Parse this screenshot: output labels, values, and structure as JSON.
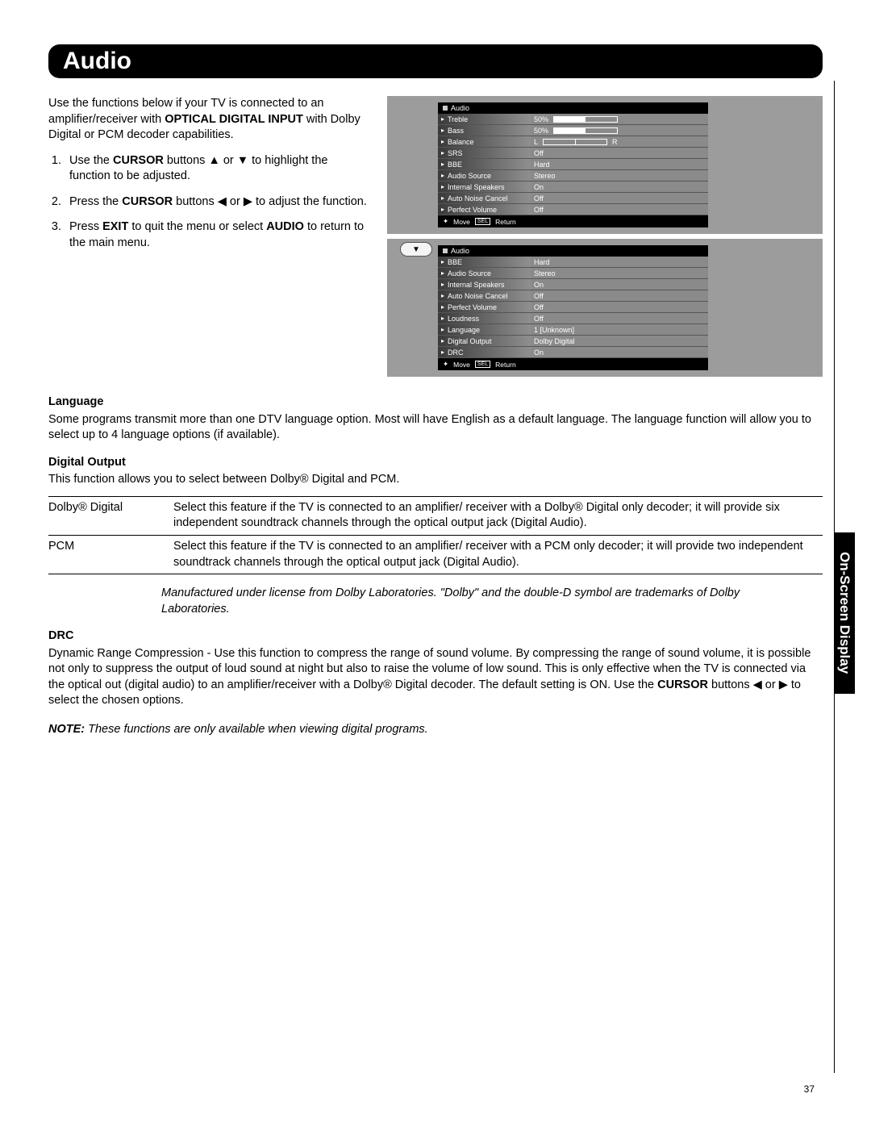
{
  "header": {
    "title": "Audio"
  },
  "side_tab": "On-Screen Display",
  "page_number": "37",
  "intro": {
    "p1a": "Use the functions below if your TV is connected to an amplifier/receiver with ",
    "p1b": "OPTICAL DIGITAL INPUT",
    "p1c": " with Dolby Digital or PCM decoder capabilities.",
    "li1a": "Use the ",
    "li1b": "CURSOR",
    "li1c": " buttons ▲ or ▼ to highlight the function to be adjusted.",
    "li2a": "Press the ",
    "li2b": "CURSOR",
    "li2c": " buttons ◀ or ▶ to adjust the function.",
    "li3a": "Press ",
    "li3b": "EXIT",
    "li3c": " to quit the menu or select ",
    "li3d": "AUDIO",
    "li3e": " to return to the main menu."
  },
  "osd1": {
    "title": "Audio",
    "rows": [
      {
        "l": "Treble",
        "r": "50%",
        "bar": true
      },
      {
        "l": "Bass",
        "r": "50%",
        "bar": true
      },
      {
        "l": "Balance",
        "r": "",
        "bal": true,
        "L": "L",
        "R": "R"
      },
      {
        "l": "SRS",
        "r": "Off"
      },
      {
        "l": "BBE",
        "r": "Hard"
      },
      {
        "l": "Audio Source",
        "r": "Stereo"
      },
      {
        "l": "Internal Speakers",
        "r": "On"
      },
      {
        "l": "Auto Noise Cancel",
        "r": "Off"
      },
      {
        "l": "Perfect Volume",
        "r": "Off"
      }
    ],
    "foot_move": "Move",
    "foot_sel": "SEL",
    "foot_ret": "Return"
  },
  "osd2": {
    "title": "Audio",
    "rows": [
      {
        "l": "BBE",
        "r": "Hard"
      },
      {
        "l": "Audio Source",
        "r": "Stereo"
      },
      {
        "l": "Internal Speakers",
        "r": "On"
      },
      {
        "l": "Auto Noise Cancel",
        "r": "Off"
      },
      {
        "l": "Perfect Volume",
        "r": "Off"
      },
      {
        "l": "Loudness",
        "r": "Off"
      },
      {
        "l": "Language",
        "r": "1 [Unknown]"
      },
      {
        "l": "Digital Output",
        "r": "Dolby Digital"
      },
      {
        "l": "DRC",
        "r": "On"
      }
    ],
    "foot_move": "Move",
    "foot_sel": "SEL",
    "foot_ret": "Return"
  },
  "language": {
    "h": "Language",
    "p": "Some programs transmit more than one DTV language option. Most will have English as a default language. The language function will allow you to select up to 4 language options (if available)."
  },
  "digital_output": {
    "h": "Digital Output",
    "p": "This function allows you to select between Dolby® Digital and PCM.",
    "rows": [
      {
        "k": "Dolby® Digital",
        "v": "Select this feature if the TV is connected to an amplifier/ receiver with a Dolby® Digital only decoder; it will provide six independent soundtrack channels through the optical output jack (Digital Audio)."
      },
      {
        "k": "PCM",
        "v": "Select this feature if the TV is connected to an amplifier/ receiver with a PCM only decoder; it will provide two independent soundtrack channels through the optical output jack (Digital Audio)."
      }
    ],
    "note": "Manufactured under license from Dolby Laboratories. \"Dolby\" and the double-D symbol are trademarks of Dolby Laboratories."
  },
  "drc": {
    "h": "DRC",
    "p1": "Dynamic Range Compression - Use this function to compress the range of sound volume. By compressing the range of sound volume, it is possible not only to suppress the output of loud sound at night but also to raise the volume of low sound. This is only effective when the TV is connected via the optical out (digital audio) to an amplifier/receiver with a Dolby® Digital decoder. The default setting is ON. Use the ",
    "p1b": "CURSOR",
    "p1c": " buttons ◀ or ▶ to select the chosen options."
  },
  "final_note": {
    "b": "NOTE:",
    "t": " These functions are only available when viewing digital programs."
  },
  "glyph": {
    "down": "▼",
    "diamond": "✦",
    "tri_r": "▸"
  }
}
